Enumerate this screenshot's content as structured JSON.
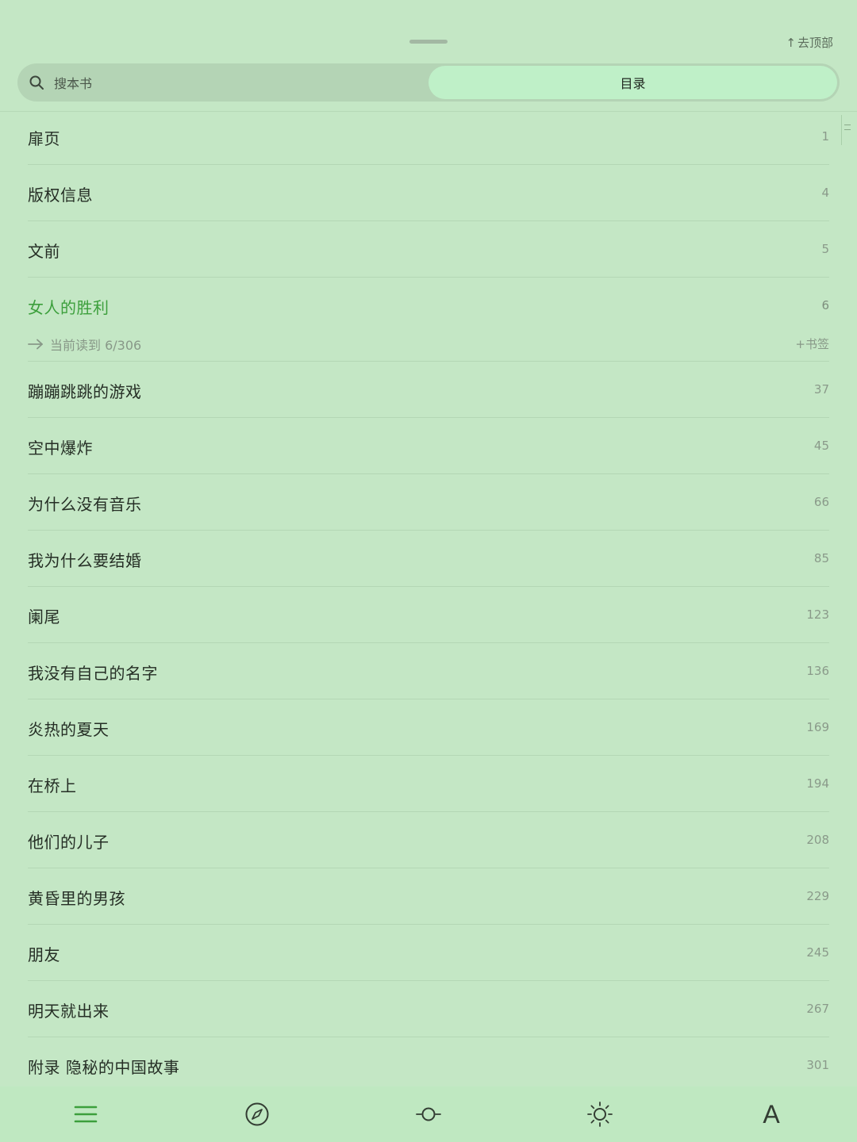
{
  "header": {
    "go_top_label": "去顶部"
  },
  "tabs": {
    "search_label": "搜本书",
    "toc_label": "目录"
  },
  "toc": [
    {
      "title": "扉页",
      "page": "1"
    },
    {
      "title": "版权信息",
      "page": "4"
    },
    {
      "title": "文前",
      "page": "5"
    },
    {
      "title": "女人的胜利",
      "page": "6",
      "current": true,
      "reading_status": "当前读到 6/306",
      "bookmark_label": "+书签"
    },
    {
      "title": "蹦蹦跳跳的游戏",
      "page": "37"
    },
    {
      "title": "空中爆炸",
      "page": "45"
    },
    {
      "title": "为什么没有音乐",
      "page": "66"
    },
    {
      "title": "我为什么要结婚",
      "page": "85"
    },
    {
      "title": "阑尾",
      "page": "123"
    },
    {
      "title": "我没有自己的名字",
      "page": "136"
    },
    {
      "title": "炎热的夏天",
      "page": "169"
    },
    {
      "title": "在桥上",
      "page": "194"
    },
    {
      "title": "他们的儿子",
      "page": "208"
    },
    {
      "title": "黄昏里的男孩",
      "page": "229"
    },
    {
      "title": "朋友",
      "page": "245"
    },
    {
      "title": "明天就出来",
      "page": "267"
    },
    {
      "title": "附录 隐秘的中国故事",
      "page": "301"
    }
  ],
  "bottom_bar": {
    "items": [
      {
        "icon": "menu-icon",
        "active": true
      },
      {
        "icon": "compass-icon"
      },
      {
        "icon": "progress-icon"
      },
      {
        "icon": "brightness-icon"
      },
      {
        "icon": "font-icon",
        "glyph": "A"
      }
    ],
    "active_color": "#3c9f3c"
  },
  "colors": {
    "background": "#c4e7c5",
    "accent": "#3c9f3c",
    "tab_active": "#bff0c8"
  }
}
